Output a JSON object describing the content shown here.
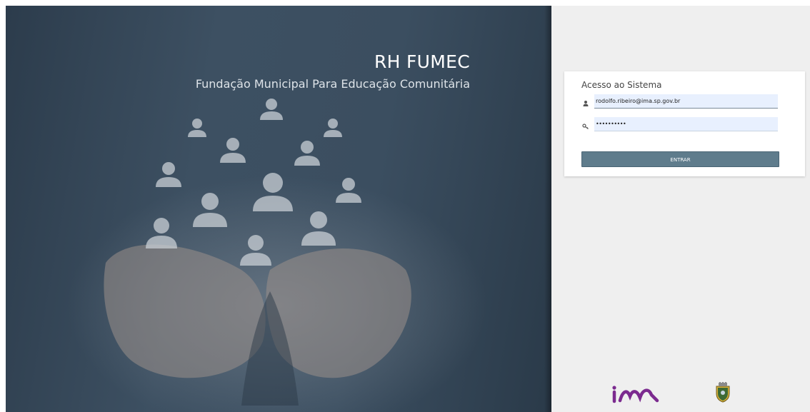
{
  "hero": {
    "title": "RH FUMEC",
    "subtitle": "Fundação Municipal Para Educação Comunitária",
    "image": "hands-holding-people-icons"
  },
  "login": {
    "card_title": "Acesso ao Sistema",
    "email_value": "rodolfo.ribeiro@ima.sp.gov.br",
    "password_value": "••••••••••",
    "enter_label": "ENTRAR",
    "user_icon": "user-icon",
    "key_icon": "key-icon"
  },
  "footer": {
    "logo_ima": "IMA",
    "crest": "municipal-crest"
  },
  "colors": {
    "accent": "#5f7c8c",
    "ima_purple": "#7b2a8f",
    "input_bg": "#e8f0fe",
    "side_bg": "#efefef"
  }
}
